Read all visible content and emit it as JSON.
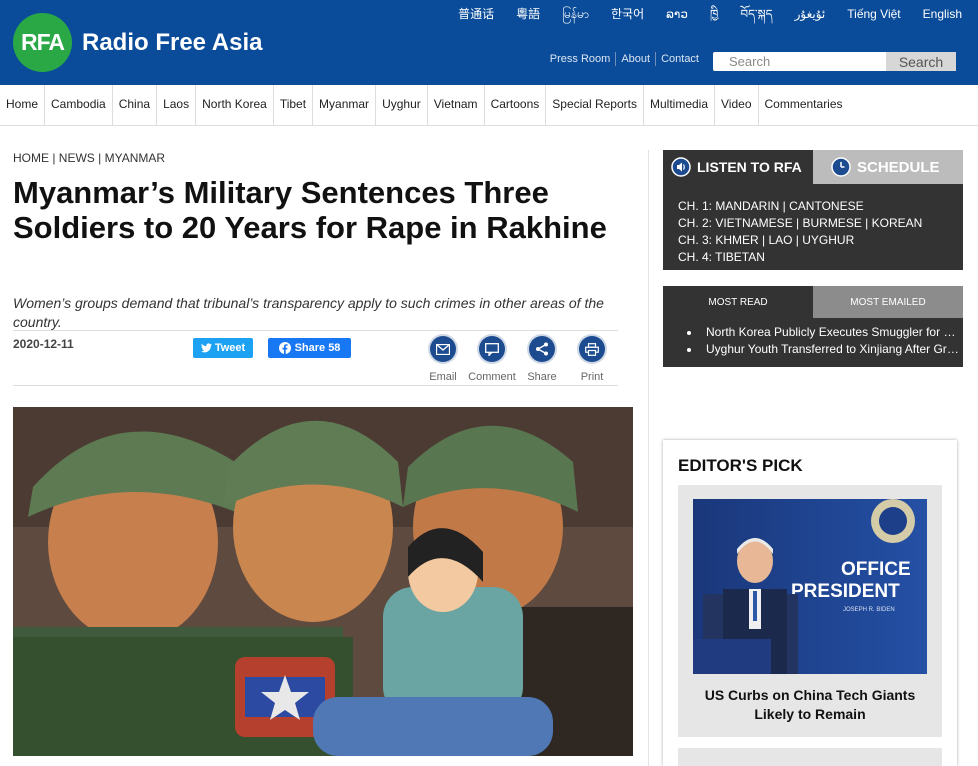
{
  "header": {
    "logo_text": "RFA",
    "site_name": "Radio Free Asia",
    "languages": [
      "普通话",
      "粵語",
      "မြန်မာ",
      "한국어",
      "ລາວ",
      "ཁྱི",
      "བོད་སྐད",
      "ئۇيغۇر",
      "Tiếng Việt",
      "English"
    ],
    "utility_links": [
      "Press Room",
      "About",
      "Contact"
    ],
    "search_placeholder": "Search",
    "search_button": "Search"
  },
  "nav": [
    "Home",
    "Cambodia",
    "China",
    "Laos",
    "North Korea",
    "Tibet",
    "Myanmar",
    "Uyghur",
    "Vietnam",
    "Cartoons",
    "Special Reports",
    "Multimedia",
    "Video",
    "Commentaries"
  ],
  "article": {
    "breadcrumb": [
      "HOME",
      "NEWS",
      "MYANMAR"
    ],
    "title": "Myanmar’s Military Sentences Three Soldiers to 20 Years for Rape in Rakhine",
    "subtitle": "Women’s groups demand that tribunal’s transparency apply to such crimes in other areas of the country.",
    "date": "2020-12-11",
    "tweet_label": "Tweet",
    "share_label": "Share 58",
    "tools": [
      "Email",
      "Comment",
      "Share",
      "Print"
    ]
  },
  "sidebar": {
    "listen_label": "LISTEN TO RFA",
    "schedule_label": "SCHEDULE",
    "channels": [
      "CH. 1: MANDARIN | CANTONESE",
      "CH. 2: VIETNAMESE | BURMESE | KOREAN",
      "CH. 3: KHMER | LAO | UYGHUR",
      "CH. 4: TIBETAN"
    ],
    "most_read_label": "MOST READ",
    "most_emailed_label": "MOST EMAILED",
    "most_read": [
      "North Korea Publicly Executes Smuggler for Bringing In Foreign Media",
      "Uyghur Youth Transferred to Xinjiang After Graduation"
    ],
    "editors_pick_label": "EDITOR'S PICK",
    "pick_title": "US Curbs on China Tech Giants Likely to Remain",
    "pick_image_text": [
      "OFFICE",
      "PRESIDENT",
      "JOSEPH R. BIDEN"
    ]
  },
  "colors": {
    "header_blue": "#0a4c99",
    "logo_green": "#2aa846",
    "tweet_blue": "#1da1f2",
    "facebook_blue": "#1877f2",
    "tool_blue": "#1c4b8f"
  }
}
